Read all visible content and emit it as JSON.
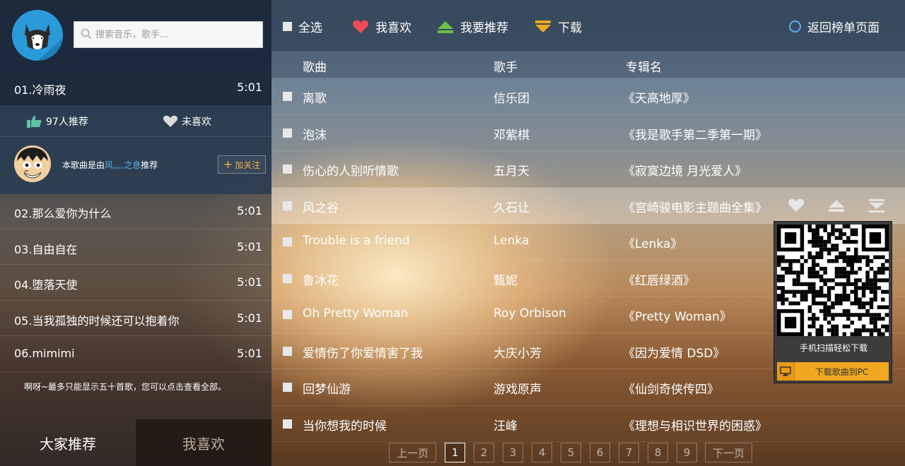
{
  "search": {
    "placeholder": "搜索音乐，歌手..."
  },
  "current": {
    "title": "01.冷雨夜",
    "duration": "5:01",
    "recommend_count_text": "97人推荐",
    "like_status": "未喜欢",
    "recommender_prefix": "本歌曲是由",
    "recommender_name": "风,,,,之息",
    "recommender_suffix": "推荐",
    "follow_label": "加关注"
  },
  "playlist": [
    {
      "title": "02.那么爱你为什么",
      "duration": "5:01"
    },
    {
      "title": "03.自由自在",
      "duration": "5:01"
    },
    {
      "title": "04.堕落天使",
      "duration": "5:01"
    },
    {
      "title": "05.当我孤独的时候还可以抱着你",
      "duration": "5:01"
    },
    {
      "title": "06.mimimi",
      "duration": "5:01"
    }
  ],
  "note": "啊呀~最多只能显示五十首歌，您可以点击查看全部。",
  "bottom_tabs": [
    "大家推荐",
    "我喜欢"
  ],
  "toolbar": {
    "select_all": "全选",
    "favorite": "我喜欢",
    "recommend": "我要推荐",
    "download": "下载",
    "back": "返回榜单页面"
  },
  "headers": {
    "song": "歌曲",
    "artist": "歌手",
    "album": "专辑名"
  },
  "songs": [
    {
      "song": "离歌",
      "artist": "信乐团",
      "album": "《天高地厚》"
    },
    {
      "song": "泡沫",
      "artist": "邓紫棋",
      "album": "《我是歌手第二季第一期》"
    },
    {
      "song": "伤心的人别听情歌",
      "artist": "五月天",
      "album": "《寂寞边境 月光爱人》"
    },
    {
      "song": "风之谷",
      "artist": "久石让",
      "album": "《宫崎骏电影主题曲全集》"
    },
    {
      "song": "Trouble is a friend",
      "artist": "Lenka",
      "album": "《Lenka》"
    },
    {
      "song": "鲁冰花",
      "artist": "甄妮",
      "album": "《红唇绿酒》"
    },
    {
      "song": "Oh Pretty Woman",
      "artist": "Roy Orbison",
      "album": "《Pretty Woman》"
    },
    {
      "song": "爱情伤了你爱情害了我",
      "artist": "大庆小芳",
      "album": "《因为爱情 DSD》"
    },
    {
      "song": "回梦仙游",
      "artist": "游戏原声",
      "album": "《仙剑奇侠传四》"
    },
    {
      "song": "当你想我的时候",
      "artist": "汪峰",
      "album": "《理想与相识世界的困惑》"
    }
  ],
  "highlighted_row": 4,
  "pager": {
    "prev": "上一页",
    "next": "下一页",
    "pages": [
      "1",
      "2",
      "3",
      "4",
      "5",
      "6",
      "7",
      "8",
      "9"
    ],
    "current": "1"
  },
  "qr_popup": {
    "caption": "手机扫描轻松下载",
    "download_pc": "下载歌曲到PC"
  },
  "colors": {
    "accent_blue": "#59b3ee",
    "heart_red": "#ef4c58",
    "recommend_green": "#6ec04a",
    "download_orange": "#f0a820",
    "recommend_thumb": "#62c3a4"
  }
}
